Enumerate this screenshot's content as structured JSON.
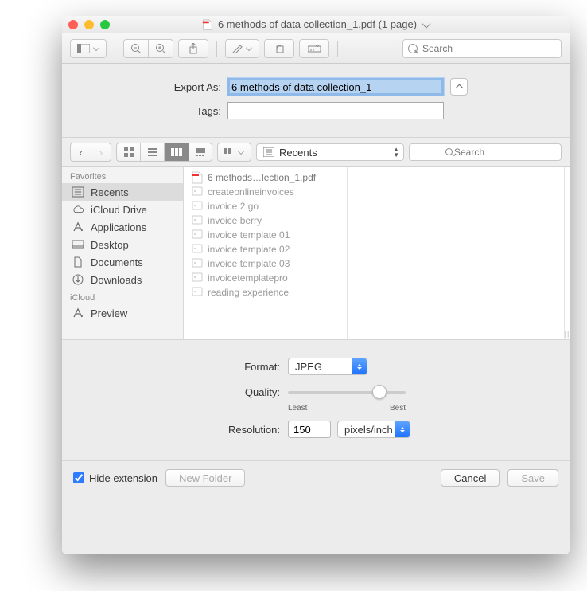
{
  "window": {
    "title": "6 methods of data collection_1.pdf (1 page)"
  },
  "toolbar": {
    "search_placeholder": "Search"
  },
  "export": {
    "export_as_label": "Export As:",
    "export_as_value": "6 methods of data collection_1",
    "tags_label": "Tags:",
    "tags_value": ""
  },
  "browser": {
    "location": "Recents",
    "search_placeholder": "Search",
    "sidebar": {
      "sections": [
        {
          "title": "Favorites",
          "items": [
            {
              "label": "Recents",
              "icon": "recents",
              "selected": true
            },
            {
              "label": "iCloud Drive",
              "icon": "cloud"
            },
            {
              "label": "Applications",
              "icon": "app"
            },
            {
              "label": "Desktop",
              "icon": "desktop"
            },
            {
              "label": "Documents",
              "icon": "doc"
            },
            {
              "label": "Downloads",
              "icon": "download"
            }
          ]
        },
        {
          "title": "iCloud",
          "items": [
            {
              "label": "Preview",
              "icon": "app"
            }
          ]
        }
      ]
    },
    "files": [
      {
        "name": "6 methods…lection_1.pdf",
        "type": "pdf",
        "selected": true
      },
      {
        "name": "createonlineinvoices",
        "type": "folder"
      },
      {
        "name": "invoice 2 go",
        "type": "folder"
      },
      {
        "name": "invoice berry",
        "type": "folder"
      },
      {
        "name": "invoice template 01",
        "type": "folder"
      },
      {
        "name": "invoice template 02",
        "type": "folder"
      },
      {
        "name": "invoice template 03",
        "type": "folder"
      },
      {
        "name": "invoicetemplatepro",
        "type": "folder"
      },
      {
        "name": "reading experience",
        "type": "folder"
      }
    ]
  },
  "options": {
    "format_label": "Format:",
    "format_value": "JPEG",
    "quality_label": "Quality:",
    "quality_least": "Least",
    "quality_best": "Best",
    "resolution_label": "Resolution:",
    "resolution_value": "150",
    "resolution_units": "pixels/inch"
  },
  "bottom": {
    "hide_ext_label": "Hide extension",
    "hide_ext_checked": true,
    "new_folder": "New Folder",
    "cancel": "Cancel",
    "save": "Save"
  }
}
